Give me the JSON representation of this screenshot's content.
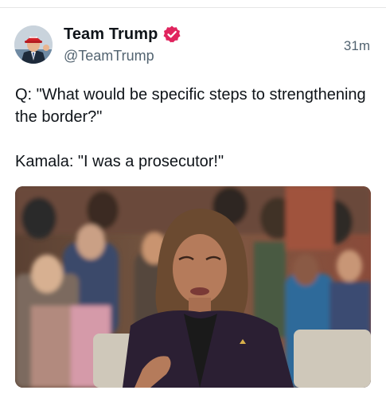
{
  "post": {
    "author": {
      "display_name": "Team Trump",
      "handle": "@TeamTrump",
      "verified": true,
      "verified_badge_color": "#e0245e",
      "avatar_icon": "avatar-photo"
    },
    "timestamp": "31m",
    "text_lines": [
      "Q: \"What would be specific steps to strengthening the border?\"",
      "Kamala: \"I was a prosecutor!\""
    ],
    "media": {
      "type": "video-still",
      "icon": "media-photo"
    }
  },
  "colors": {
    "text_primary": "#0f1419",
    "text_secondary": "#536471",
    "background": "#ffffff"
  }
}
